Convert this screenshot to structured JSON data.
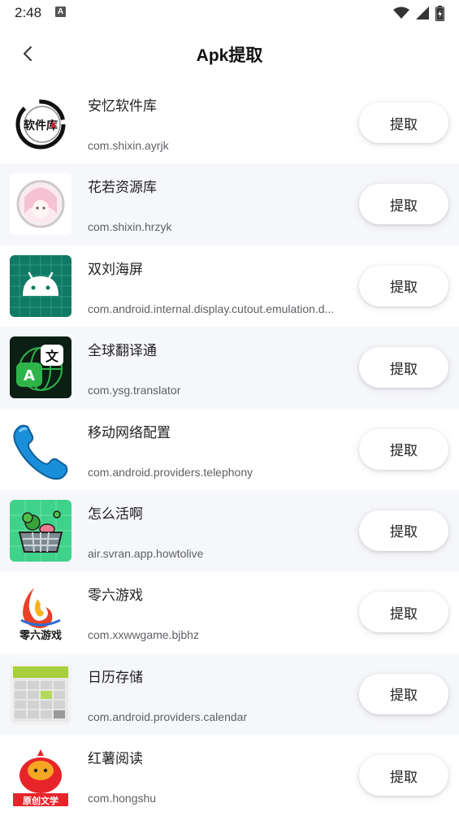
{
  "status_bar": {
    "time": "2:48",
    "indicator": "A",
    "icons": [
      "wifi-icon",
      "signal-icon",
      "battery-charging-icon"
    ]
  },
  "header": {
    "title": "Apk提取",
    "back_icon": "chevron-left-icon"
  },
  "apps": [
    {
      "name": "安忆软件库",
      "package": "com.shixin.ayrjk",
      "button": "提取",
      "icon": "ink-brush-logo"
    },
    {
      "name": "花若资源库",
      "package": "com.shixin.hrzyk",
      "button": "提取",
      "icon": "anime-avatar"
    },
    {
      "name": "双刘海屏",
      "package": "com.android.internal.display.cutout.emulation.d...",
      "button": "提取",
      "icon": "android-robot"
    },
    {
      "name": "全球翻译通",
      "package": "com.ysg.translator",
      "button": "提取",
      "icon": "translate-globe"
    },
    {
      "name": "移动网络配置",
      "package": "com.android.providers.telephony",
      "button": "提取",
      "icon": "phone-handset"
    },
    {
      "name": "怎么活啊",
      "package": "air.svran.app.howtolive",
      "button": "提取",
      "icon": "vegetable-basket"
    },
    {
      "name": "零六游戏",
      "package": "com.xxwwgame.bjbhz",
      "button": "提取",
      "icon": "flame-game-logo"
    },
    {
      "name": "日历存储",
      "package": "com.android.providers.calendar",
      "button": "提取",
      "icon": "calendar-grid"
    },
    {
      "name": "红薯阅读",
      "package": "com.hongshu",
      "button": "提取",
      "icon": "sweet-potato-mascot"
    }
  ],
  "icon_text": {
    "ayrjk": "软件库",
    "translator_a": "A",
    "translator_zh": "文",
    "game_logo": "零六游戏",
    "reader_banner": "原创文学"
  },
  "colors": {
    "row_alt": "#f6f7fb",
    "android_bg": "#117a64",
    "translator_green": "#2fb44a",
    "phone_blue": "#1a8fd9",
    "basket_bg": "#3fd28a",
    "reader_red": "#e8242b"
  }
}
